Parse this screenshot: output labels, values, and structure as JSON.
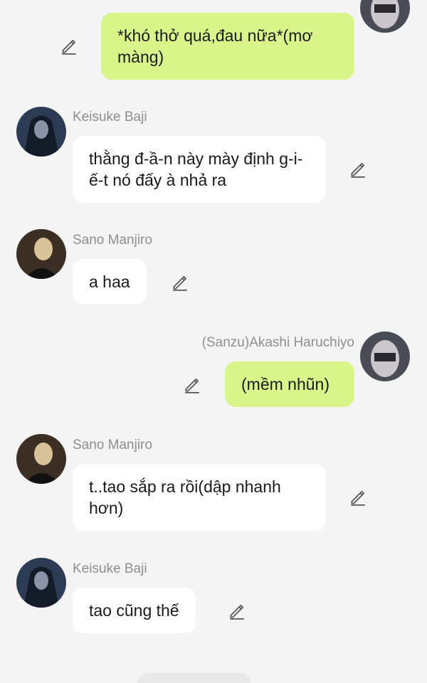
{
  "messages": [
    {
      "id": "m1",
      "side": "out",
      "sender": "",
      "text": "*khó thở quá,đau nữa*(mơ màng)"
    },
    {
      "id": "m2",
      "side": "in",
      "sender": "Keisuke Baji",
      "text": "thằng đ-ầ-n này mày định g-i-ế-t nó đấy à nhả ra"
    },
    {
      "id": "m3",
      "side": "in",
      "sender": "Sano Manjiro",
      "text": "a haa"
    },
    {
      "id": "m4",
      "side": "out",
      "sender": "(Sanzu)Akashi Haruchiyo",
      "text": "(mềm nhũn)"
    },
    {
      "id": "m5",
      "side": "in",
      "sender": "Sano Manjiro",
      "text": "t..tao sắp ra rồi(dập nhanh hơn)"
    },
    {
      "id": "m6",
      "side": "in",
      "sender": "Keisuke Baji",
      "text": "tao cũng thế"
    }
  ],
  "colors": {
    "background": "#f4f4f4",
    "incoming_bubble": "#ffffff",
    "outgoing_bubble": "#d9f58a",
    "sender_name": "#8e8e8e"
  },
  "icons": {
    "edit": "pencil-edit-icon"
  }
}
